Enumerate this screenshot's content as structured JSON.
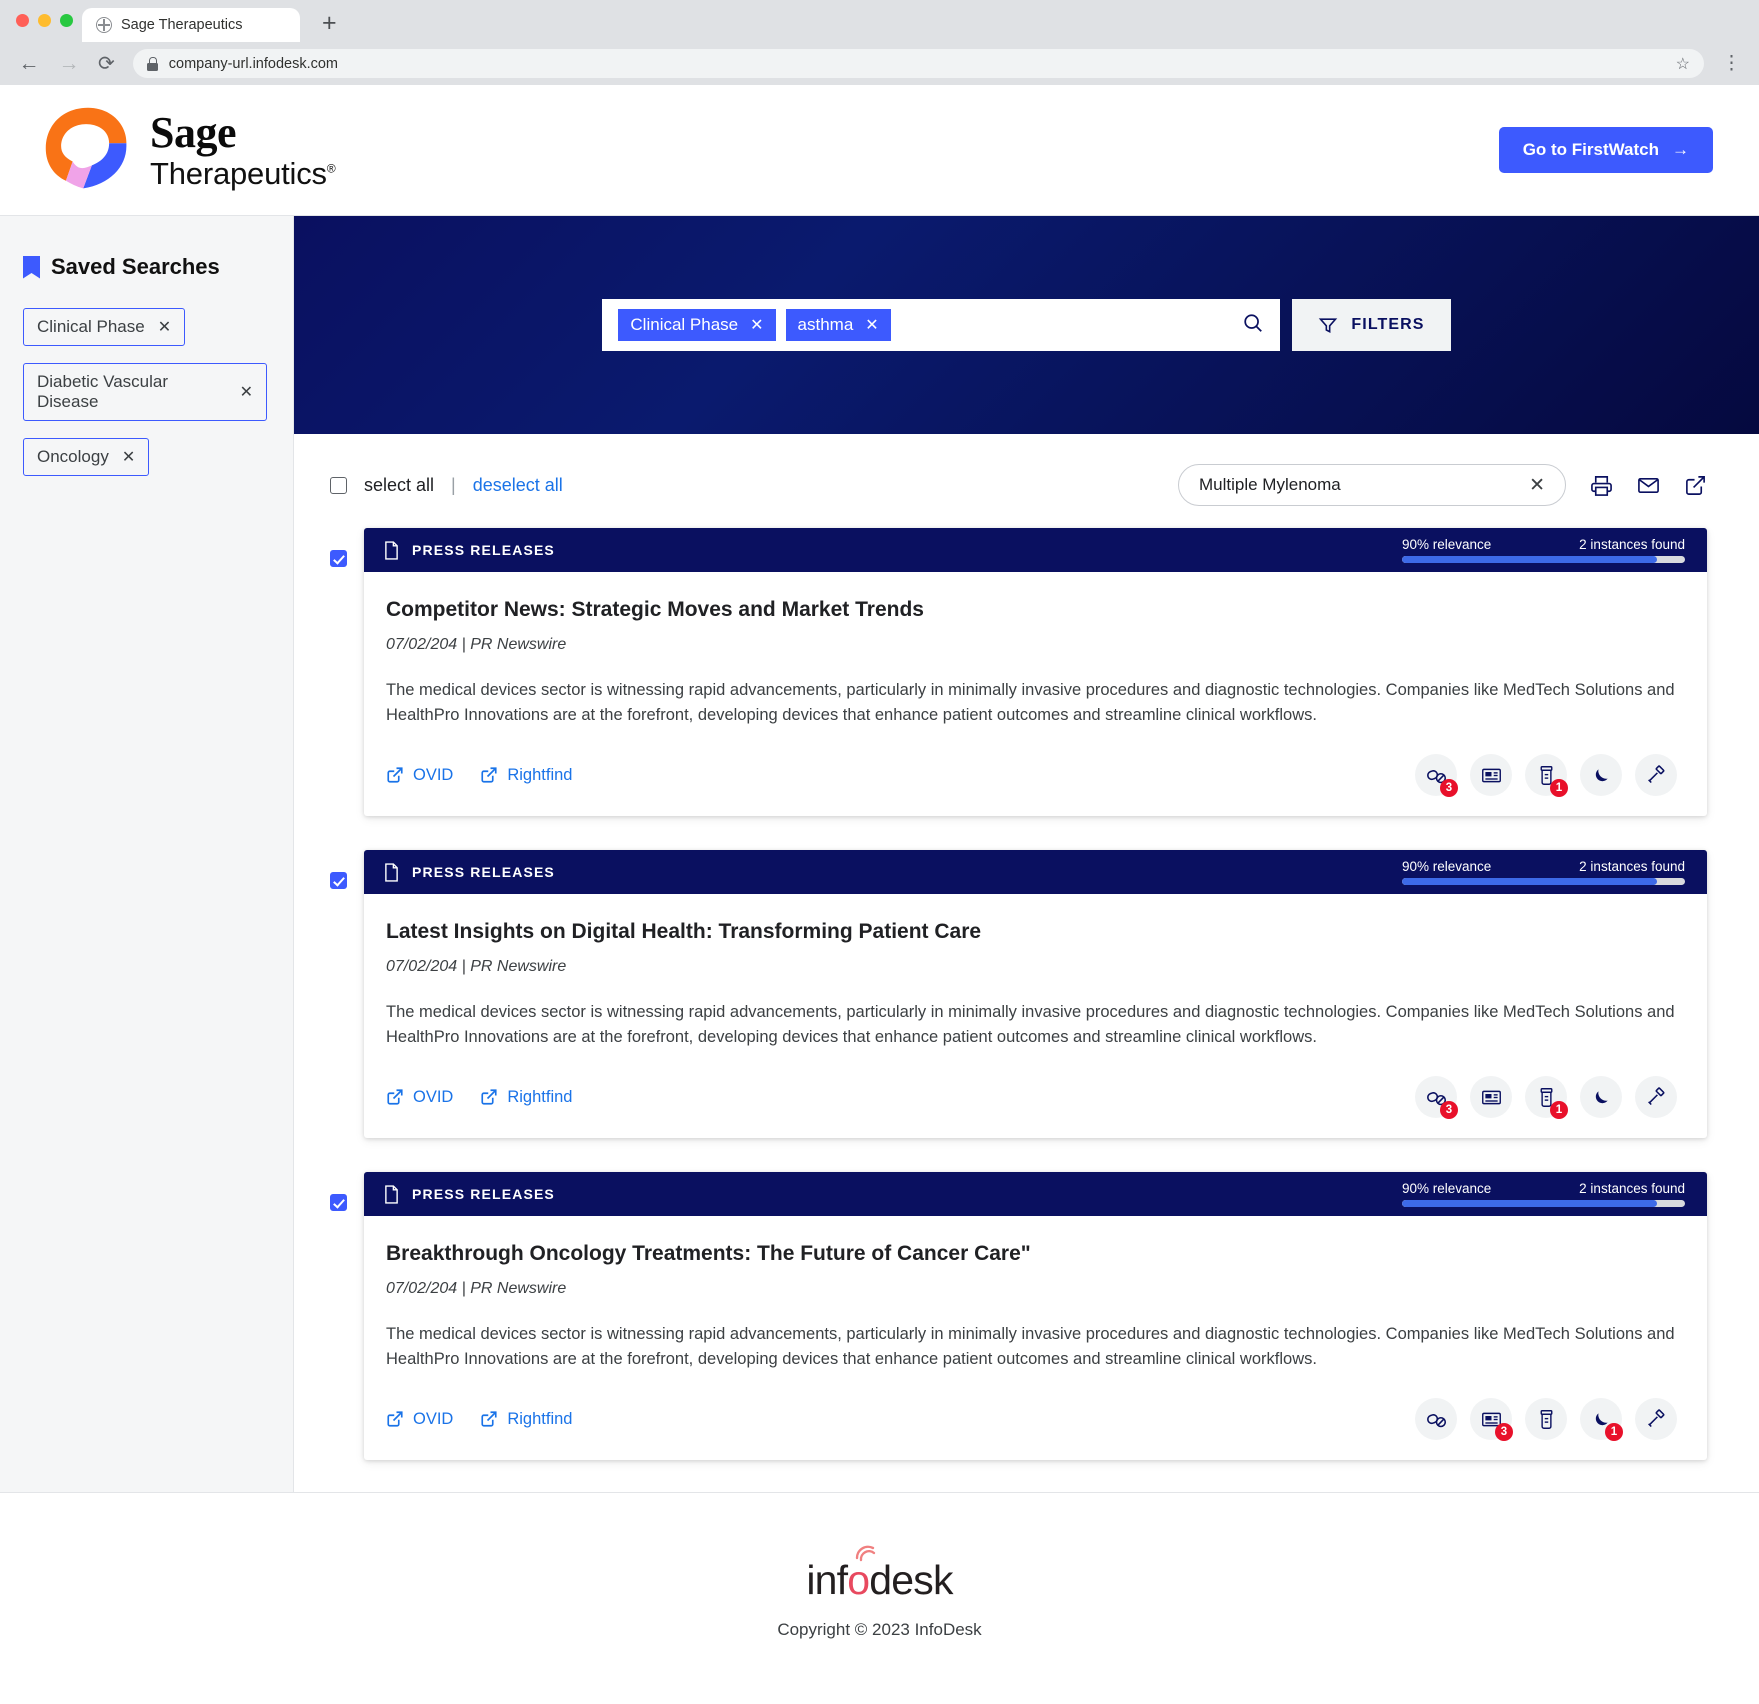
{
  "browser": {
    "tab_title": "Sage Therapeutics",
    "tab_favicon": "globe-icon",
    "new_tab_label": "+",
    "back_label": "←",
    "forward_label": "→",
    "reload_label": "⟳",
    "url": "company-url.infodesk.com",
    "star_label": "☆",
    "menu_label": "⋮"
  },
  "header": {
    "brand_name": "Sage",
    "brand_sub": "Therapeutics",
    "brand_registered": "®",
    "cta_label": "Go to FirstWatch",
    "cta_arrow": "→",
    "cta_color": "#3d5afe"
  },
  "sidebar": {
    "title": "Saved Searches",
    "saved_searches": [
      {
        "label": "Clinical Phase",
        "remove": "✕"
      },
      {
        "label": "Diabetic Vascular Disease",
        "remove": "✕"
      },
      {
        "label": "Oncology",
        "remove": "✕"
      }
    ]
  },
  "hero": {
    "background_color": "#0a1060",
    "search_terms": [
      {
        "label": "Clinical Phase",
        "remove": "✕"
      },
      {
        "label": "asthma",
        "remove": "✕"
      }
    ],
    "search_icon": "search-icon",
    "filters_label": "FILTERS",
    "filters_icon": "funnel-icon"
  },
  "toolbar": {
    "select_all_label": "select all",
    "divider": "|",
    "deselect_all_label": "deselect all",
    "filter_value": "Multiple Mylenoma",
    "filter_clear": "✕",
    "actions": [
      {
        "name": "print-icon"
      },
      {
        "name": "email-icon"
      },
      {
        "name": "export-icon"
      }
    ]
  },
  "results": [
    {
      "selected": true,
      "type": "PRESS RELEASES",
      "relevance_label": "90% relevance",
      "relevance_pct": 90,
      "instances_label": "2 instances found",
      "title": "Competitor News: Strategic Moves and Market Trends",
      "meta": "07/02/204 | PR Newswire",
      "description": "The medical devices sector is witnessing rapid advancements, particularly in minimally invasive procedures and diagnostic technologies. Companies like MedTech Solutions and HealthPro Innovations are at the forefront, developing devices that enhance patient outcomes and streamline clinical workflows.",
      "links": [
        {
          "label": "OVID",
          "icon": "external-link-icon"
        },
        {
          "label": "Rightfind",
          "icon": "external-link-icon"
        }
      ],
      "actions": [
        {
          "name": "drug-interaction-icon",
          "badge": "3"
        },
        {
          "name": "news-icon",
          "badge": ""
        },
        {
          "name": "pill-bottle-icon",
          "badge": "1"
        },
        {
          "name": "moon-icon",
          "badge": ""
        },
        {
          "name": "gavel-icon",
          "badge": ""
        }
      ]
    },
    {
      "selected": true,
      "type": "PRESS RELEASES",
      "relevance_label": "90% relevance",
      "relevance_pct": 90,
      "instances_label": "2 instances found",
      "title": "Latest Insights on Digital Health: Transforming Patient Care",
      "meta": "07/02/204 | PR Newswire",
      "description": "The medical devices sector is witnessing rapid advancements, particularly in minimally invasive procedures and diagnostic technologies. Companies like MedTech Solutions and HealthPro Innovations are at the forefront, developing devices that enhance patient outcomes and streamline clinical workflows.",
      "links": [
        {
          "label": "OVID",
          "icon": "external-link-icon"
        },
        {
          "label": "Rightfind",
          "icon": "external-link-icon"
        }
      ],
      "actions": [
        {
          "name": "drug-interaction-icon",
          "badge": "3"
        },
        {
          "name": "news-icon",
          "badge": ""
        },
        {
          "name": "pill-bottle-icon",
          "badge": "1"
        },
        {
          "name": "moon-icon",
          "badge": ""
        },
        {
          "name": "gavel-icon",
          "badge": ""
        }
      ]
    },
    {
      "selected": true,
      "type": "PRESS RELEASES",
      "relevance_label": "90% relevance",
      "relevance_pct": 90,
      "instances_label": "2 instances found",
      "title": "Breakthrough Oncology Treatments: The Future of Cancer Care\"",
      "meta": "07/02/204 | PR Newswire",
      "description": "The medical devices sector is witnessing rapid advancements, particularly in minimally invasive procedures and diagnostic technologies. Companies like MedTech Solutions and HealthPro Innovations are at the forefront, developing devices that enhance patient outcomes and streamline clinical workflows.",
      "links": [
        {
          "label": "OVID",
          "icon": "external-link-icon"
        },
        {
          "label": "Rightfind",
          "icon": "external-link-icon"
        }
      ],
      "actions": [
        {
          "name": "drug-interaction-icon",
          "badge": ""
        },
        {
          "name": "news-icon",
          "badge": "3"
        },
        {
          "name": "pill-bottle-icon",
          "badge": ""
        },
        {
          "name": "moon-icon",
          "badge": "1"
        },
        {
          "name": "gavel-icon",
          "badge": ""
        }
      ]
    }
  ],
  "footer": {
    "logo_text_1": "inf",
    "logo_text_o": "o",
    "logo_text_2": "desk",
    "copyright": "Copyright © 2023 InfoDesk"
  }
}
